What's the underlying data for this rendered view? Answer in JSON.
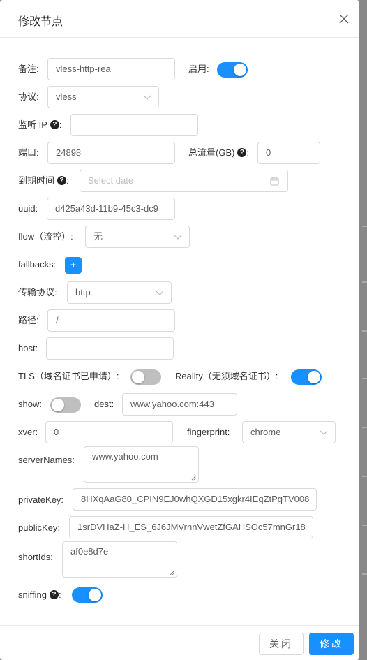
{
  "modal": {
    "title": "修改节点",
    "close_icon": "close-icon"
  },
  "fields": {
    "remark_label": "备注:",
    "remark_value": "vless-http-rea",
    "enable_label": "启用:",
    "enable_on": true,
    "protocol_label": "协议:",
    "protocol_value": "vless",
    "listen_ip_label": "监听 IP",
    "listen_ip_value": "",
    "port_label": "端口:",
    "port_value": "24898",
    "total_traffic_label": "总流量(GB)",
    "total_traffic_value": "0",
    "expiry_label": "到期时间",
    "expiry_placeholder": "Select date",
    "uuid_label": "uuid:",
    "uuid_value": "d425a43d-11b9-45c3-dc9",
    "flow_label": "flow（流控）:",
    "flow_value": "无",
    "fallbacks_label": "fallbacks:",
    "fallbacks_add": "+",
    "transport_label": "传输协议:",
    "transport_value": "http",
    "path_label": "路径:",
    "path_value": "/",
    "host_label": "host:",
    "host_value": "",
    "tls_label": "TLS（域名证书已申请）:",
    "tls_on": false,
    "reality_label": "Reality（无须域名证书）:",
    "reality_on": true,
    "show_label": "show:",
    "show_on": false,
    "dest_label": "dest:",
    "dest_value": "www.yahoo.com:443",
    "xver_label": "xver:",
    "xver_value": "0",
    "fingerprint_label": "fingerprint:",
    "fingerprint_value": "chrome",
    "server_names_label": "serverNames:",
    "server_names_value": "www.yahoo.com",
    "private_key_label": "privateKey:",
    "private_key_value": "8HXqAaG80_CPIN9EJ0whQXGD15xgkr4IEqZtPqTV008",
    "public_key_label": "publicKey:",
    "public_key_value": "1srDVHaZ-H_ES_6J6JMVrnnVwetZfGAHSOc57mnGr18",
    "short_ids_label": "shortIds:",
    "short_ids_value": "af0e8d7e",
    "sniffing_label": "sniffing",
    "sniffing_on": true,
    "colon": ":"
  },
  "footer": {
    "close_label": "关闭",
    "submit_label": "修改"
  },
  "colors": {
    "accent": "#1890ff",
    "switch_off": "#bfbfbf"
  }
}
